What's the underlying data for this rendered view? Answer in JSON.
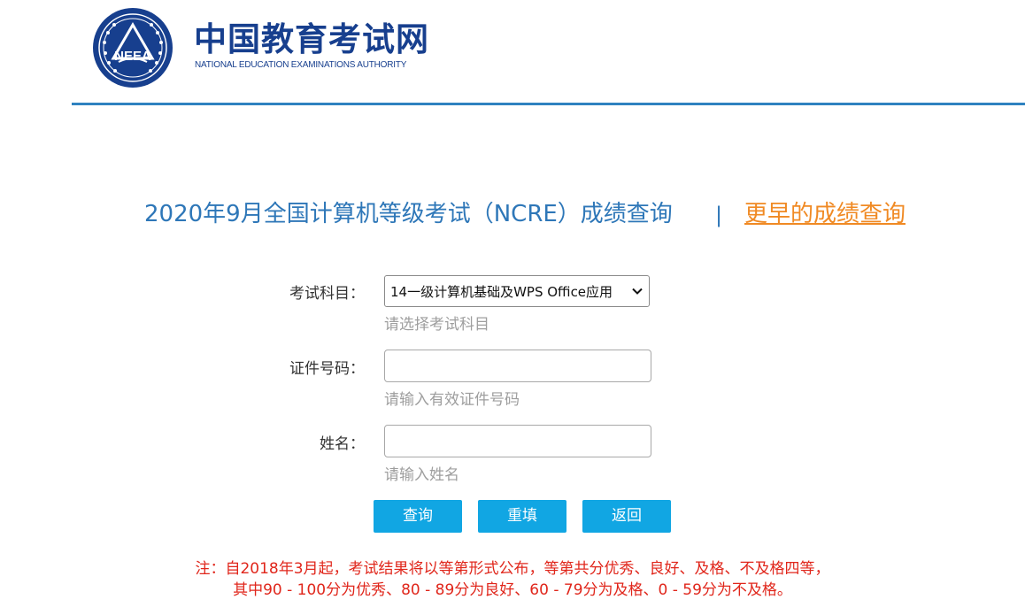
{
  "header": {
    "logo_name_cn": "中国教育考试网",
    "logo_name_en": "NATIONAL EDUCATION EXAMINATIONS AUTHORITY",
    "emblem_text": "NEEA",
    "brand_color": "#173f8e"
  },
  "title": {
    "main": "2020年9月全国计算机等级考试（NCRE）成绩查询",
    "divider": "|",
    "earlier_link": "更早的成绩查询"
  },
  "form": {
    "subject": {
      "label": "考试科目：",
      "selected": "14一级计算机基础及WPS Office应用",
      "hint": "请选择考试科目"
    },
    "id_number": {
      "label": "证件号码：",
      "value": "",
      "hint": "请输入有效证件号码"
    },
    "name": {
      "label": "姓名：",
      "value": "",
      "hint": "请输入姓名"
    }
  },
  "buttons": {
    "query": "查询",
    "reset": "重填",
    "back": "返回"
  },
  "note": {
    "line1": "注：自2018年3月起，考试结果将以等第形式公布，等第共分优秀、良好、及格、不及格四等，",
    "line2": "其中90 - 100分为优秀、80 - 89分为良好、60 - 79分为及格、0 - 59分为不及格。"
  },
  "colors": {
    "accent_blue": "#2e77b8",
    "button_blue": "#11a6e3",
    "link_orange": "#f08a24",
    "note_red": "#e0261b"
  }
}
